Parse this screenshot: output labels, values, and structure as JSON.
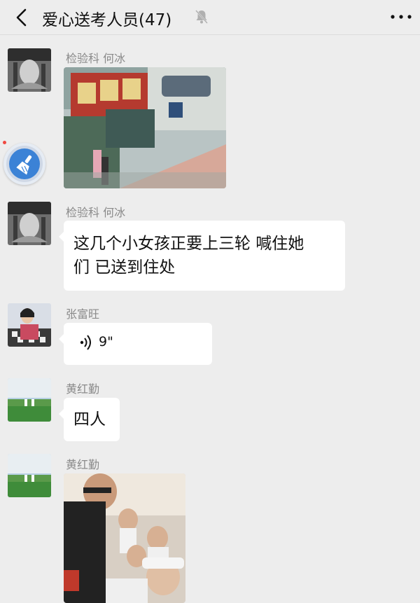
{
  "header": {
    "back_icon": "chevron-left-icon",
    "title": "爱心送考人员(47)",
    "mute_icon": "bell-muted-icon",
    "more_icon": "more-dots-icon"
  },
  "messages": [
    {
      "sender": "检验科 何冰",
      "type": "image"
    },
    {
      "sender": "检验科 何冰",
      "type": "text",
      "text_line1": "这几个小女孩正要上三轮 喊住她",
      "text_line2": "们  已送到住处"
    },
    {
      "sender": "张富旺",
      "type": "voice",
      "duration": "9\""
    },
    {
      "sender": "黄红勤",
      "type": "text",
      "text": "四人"
    },
    {
      "sender": "黄红勤",
      "type": "image"
    }
  ],
  "colors": {
    "background": "#ededed",
    "bubble": "#ffffff",
    "sender_name": "#8a8a8a",
    "float_button": "#3b82d6",
    "badge": "#f04840"
  }
}
